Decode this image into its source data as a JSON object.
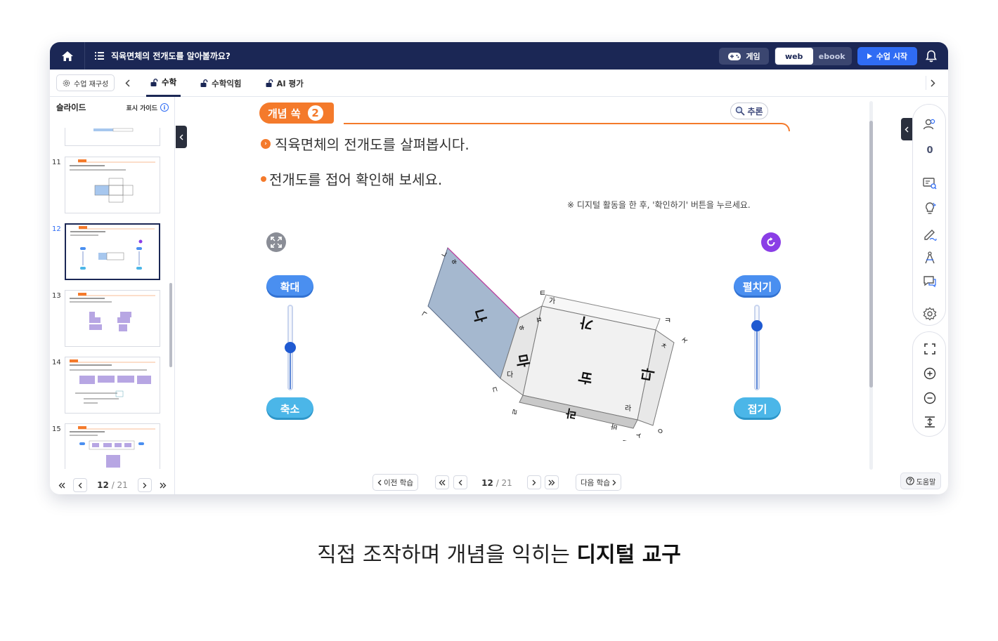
{
  "topbar": {
    "lesson_title": "직육면체의 전개도를 알아볼까요?",
    "game_label": "게임",
    "mode_web": "web",
    "mode_ebook": "ebook",
    "start_label": "수업 시작"
  },
  "subbar": {
    "restructure_label": "수업 재구성",
    "tabs": [
      {
        "label": "수학"
      },
      {
        "label": "수학익힘"
      },
      {
        "label": "AI 평가"
      }
    ]
  },
  "sidebar": {
    "title": "슬라이드",
    "guide_label": "표시 가이드",
    "thumbs": [
      {
        "num": ""
      },
      {
        "num": "11"
      },
      {
        "num": "12"
      },
      {
        "num": "13"
      },
      {
        "num": "14"
      },
      {
        "num": "15"
      }
    ],
    "current_page": "12",
    "total_pages": "/ 21"
  },
  "content": {
    "badge_label": "개념 쏙",
    "badge_num": "2",
    "reason_label": "추론",
    "question1": "직육면체의 전개도를 살펴봅시다.",
    "question2": "전개도를 접어 확인해 보세요.",
    "note": "※ 디지털 활동을 한 후, '확인하기' 버튼을 누르세요.",
    "zoom_in_label": "확대",
    "zoom_out_label": "축소",
    "unfold_label": "펼치기",
    "fold_label": "접기",
    "zoom_level": 0.5,
    "fold_level": 0.8,
    "net_faces": [
      "가",
      "나",
      "다",
      "라",
      "마",
      "바"
    ],
    "net_vertices": [
      "ㄱ",
      "ㄴ",
      "ㄷ",
      "ㄹ",
      "ㅁ",
      "ㅂ",
      "ㅅ",
      "ㅇ",
      "ㅈ",
      "ㅊ",
      "ㅋ",
      "ㅌ",
      "ㅍ",
      "ㅎ"
    ]
  },
  "bottom_nav": {
    "prev_label": "이전 학습",
    "next_label": "다음 학습",
    "current_page": "12",
    "total_pages": "/ 21",
    "help_label": "도움말"
  },
  "toolbar": {
    "participant_count": "0"
  },
  "caption": {
    "normal": "직접 조작하며 개념을 익히는 ",
    "bold": "디지털 교구"
  },
  "colors": {
    "navy": "#1b2755",
    "orange": "#f47a2b",
    "accent_blue": "#2f6cf4"
  }
}
